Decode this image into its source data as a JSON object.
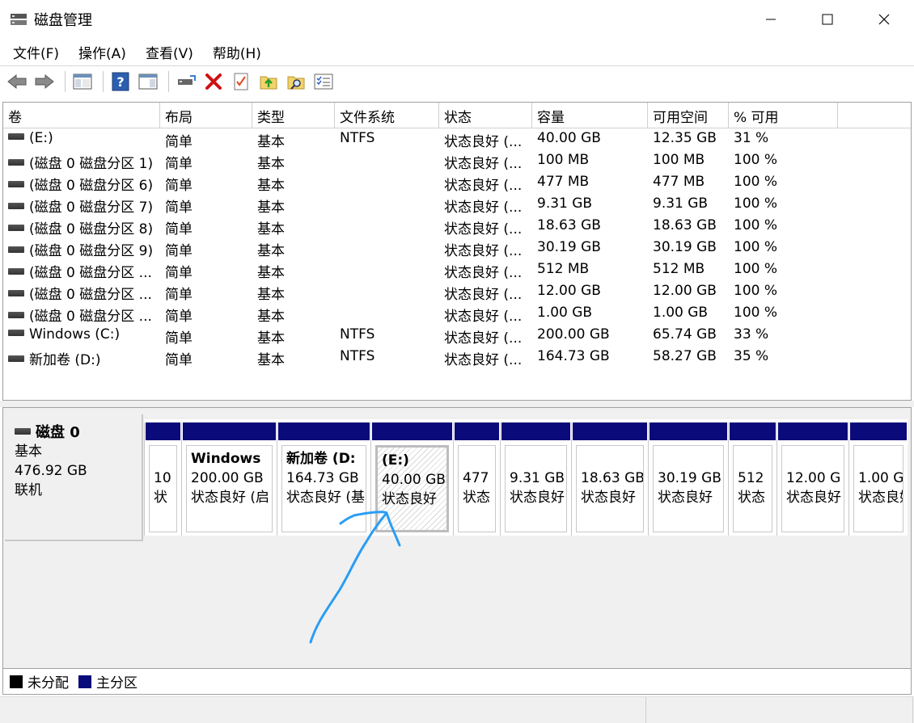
{
  "window": {
    "title": "磁盘管理"
  },
  "menu": [
    "文件(F)",
    "操作(A)",
    "查看(V)",
    "帮助(H)"
  ],
  "table": {
    "columns": [
      "卷",
      "布局",
      "类型",
      "文件系统",
      "状态",
      "容量",
      "可用空间",
      "% 可用"
    ],
    "rows": [
      [
        "(E:)",
        "简单",
        "基本",
        "NTFS",
        "状态良好 (...",
        "40.00 GB",
        "12.35 GB",
        "31 %"
      ],
      [
        "(磁盘 0 磁盘分区 1)",
        "简单",
        "基本",
        "",
        "状态良好 (...",
        "100 MB",
        "100 MB",
        "100 %"
      ],
      [
        "(磁盘 0 磁盘分区 6)",
        "简单",
        "基本",
        "",
        "状态良好 (...",
        "477 MB",
        "477 MB",
        "100 %"
      ],
      [
        "(磁盘 0 磁盘分区 7)",
        "简单",
        "基本",
        "",
        "状态良好 (...",
        "9.31 GB",
        "9.31 GB",
        "100 %"
      ],
      [
        "(磁盘 0 磁盘分区 8)",
        "简单",
        "基本",
        "",
        "状态良好 (...",
        "18.63 GB",
        "18.63 GB",
        "100 %"
      ],
      [
        "(磁盘 0 磁盘分区 9)",
        "简单",
        "基本",
        "",
        "状态良好 (...",
        "30.19 GB",
        "30.19 GB",
        "100 %"
      ],
      [
        "(磁盘 0 磁盘分区 ...",
        "简单",
        "基本",
        "",
        "状态良好 (...",
        "512 MB",
        "512 MB",
        "100 %"
      ],
      [
        "(磁盘 0 磁盘分区 ...",
        "简单",
        "基本",
        "",
        "状态良好 (...",
        "12.00 GB",
        "12.00 GB",
        "100 %"
      ],
      [
        "(磁盘 0 磁盘分区 ...",
        "简单",
        "基本",
        "",
        "状态良好 (...",
        "1.00 GB",
        "1.00 GB",
        "100 %"
      ],
      [
        "Windows (C:)",
        "简单",
        "基本",
        "NTFS",
        "状态良好 (...",
        "200.00 GB",
        "65.74 GB",
        "33 %"
      ],
      [
        "新加卷 (D:)",
        "简单",
        "基本",
        "NTFS",
        "状态良好 (...",
        "164.73 GB",
        "58.27 GB",
        "35 %"
      ]
    ]
  },
  "disk": {
    "name": "磁盘 0",
    "type": "基本",
    "size": "476.92 GB",
    "status": "联机",
    "partitions": [
      {
        "name": "",
        "size": "10",
        "status": "状"
      },
      {
        "name": "Windows",
        "size": "200.00 GB",
        "status": "状态良好 (启"
      },
      {
        "name": "新加卷 (D:",
        "size": "164.73 GB",
        "status": "状态良好 (基"
      },
      {
        "name": "(E:)",
        "size": "40.00 GB",
        "status": "状态良好",
        "selected": true
      },
      {
        "name": "",
        "size": "477",
        "status": "状态"
      },
      {
        "name": "",
        "size": "9.31 GB",
        "status": "状态良好"
      },
      {
        "name": "",
        "size": "18.63 GB",
        "status": "状态良好"
      },
      {
        "name": "",
        "size": "30.19 GB",
        "status": "状态良好"
      },
      {
        "name": "",
        "size": "512",
        "status": "状态"
      },
      {
        "name": "",
        "size": "12.00 G",
        "status": "状态良好"
      },
      {
        "name": "",
        "size": "1.00 G",
        "status": "状态良好"
      }
    ]
  },
  "legend": [
    {
      "label": "未分配",
      "color": "#000000"
    },
    {
      "label": "主分区",
      "color": "#0a0a7a"
    }
  ],
  "colors": {
    "primary_partition": "#0a0a7a",
    "annotation_arrow": "#2a9df4"
  }
}
